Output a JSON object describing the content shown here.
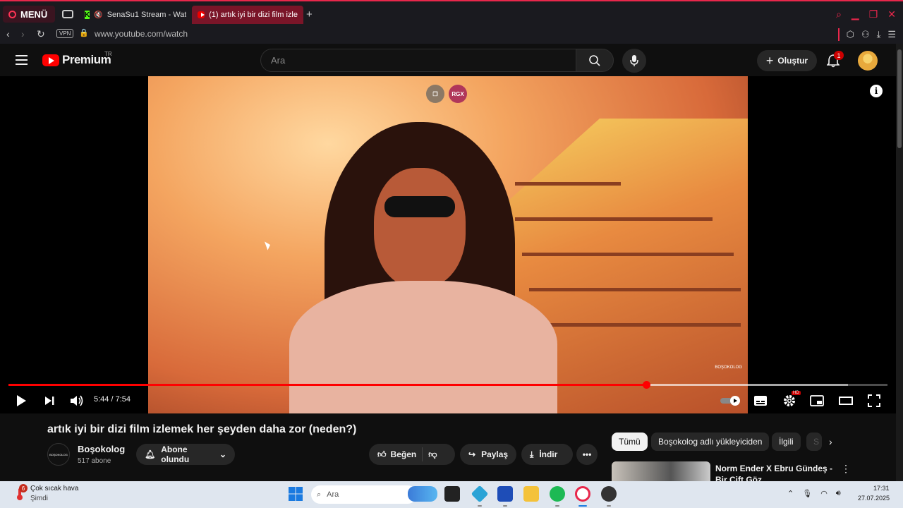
{
  "browser": {
    "menu_label": "MENÜ",
    "tabs": [
      {
        "label": "SenaSu1 Stream - Wat"
      },
      {
        "label": "(1) artık iyi bir dizi film izle"
      }
    ],
    "vpn_label": "VPN",
    "url": "www.youtube.com/watch",
    "accent_color": "#e8274b"
  },
  "yt_header": {
    "logo_text": "Premium",
    "region": "TR",
    "search_placeholder": "Ara",
    "create_label": "Oluştur",
    "notification_count": "1"
  },
  "player": {
    "time_display": "5:44 / 7:54",
    "progress_fraction": 0.7257,
    "buffer_fraction": 0.955,
    "hd_badge": "HD",
    "overlay_label": "RGX",
    "watermark": "BOŞOKOLOG"
  },
  "video_info": {
    "title": "artık iyi bir dizi film izlemek her şeyden daha zor (neden?)",
    "channel_name": "Boşokolog",
    "channel_avatar_text": "BOŞOKOLOG",
    "subscribers": "517 abone",
    "subscribe_label": "Abone olundu",
    "like_label": "Beğen",
    "share_label": "Paylaş",
    "download_label": "İndir"
  },
  "chips": [
    {
      "label": "Tümü",
      "active": true
    },
    {
      "label": "Boşokolog adlı yükleyiciden",
      "active": false
    },
    {
      "label": "İlgili",
      "active": false
    },
    {
      "label": "S",
      "active": false
    }
  ],
  "recommendation": {
    "title": "Norm Ender X Ebru Gündeş - Bir Çift Göz"
  },
  "taskbar": {
    "weather_title": "Çok sıcak hava",
    "weather_sub": "Şimdi",
    "weather_badge": "6",
    "search_label": "Ara",
    "time": "17:31",
    "date": "27.07.2025"
  }
}
